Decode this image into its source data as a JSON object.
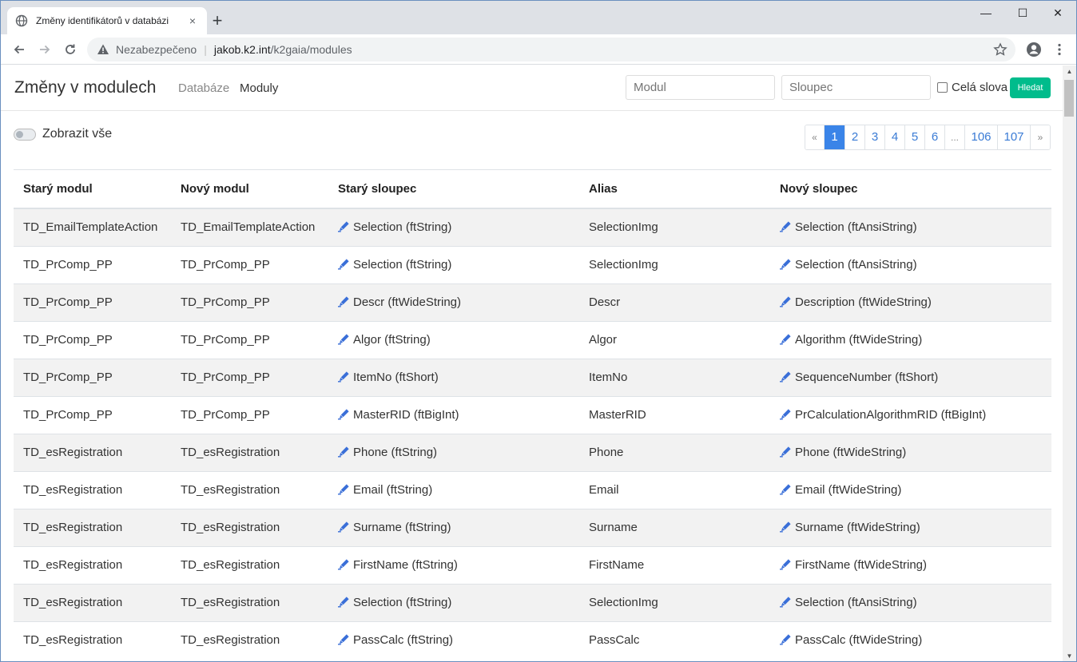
{
  "browser": {
    "tab_title": "Změny identifikátorů v databázi",
    "tab_close": "×",
    "new_tab": "+",
    "minimize": "—",
    "maximize": "☐",
    "close": "✕",
    "address": {
      "security_label": "Nezabezpečeno",
      "separator": "|",
      "host": "jakob.k2.int",
      "path": "/k2gaia/modules"
    }
  },
  "navbar": {
    "brand": "Změny v modulech",
    "links": [
      {
        "label": "Databáze",
        "active": false
      },
      {
        "label": "Moduly",
        "active": true
      }
    ],
    "search_module_placeholder": "Modul",
    "search_column_placeholder": "Sloupec",
    "whole_words_label": "Celá slova",
    "search_button": "Hledat"
  },
  "toolbar": {
    "show_all_label": "Zobrazit vše",
    "show_all_on": false
  },
  "pagination": {
    "prev": "«",
    "pages": [
      "1",
      "2",
      "3",
      "4",
      "5",
      "6",
      "...",
      "106",
      "107"
    ],
    "active_page": "1",
    "next": "»"
  },
  "table": {
    "headers": [
      "Starý modul",
      "Nový modul",
      "Starý sloupec",
      "Alias",
      "Nový sloupec"
    ],
    "rows": [
      [
        "TD_EmailTemplateAction",
        "TD_EmailTemplateAction",
        "Selection (ftString)",
        "SelectionImg",
        "Selection (ftAnsiString)"
      ],
      [
        "TD_PrComp_PP",
        "TD_PrComp_PP",
        "Selection (ftString)",
        "SelectionImg",
        "Selection (ftAnsiString)"
      ],
      [
        "TD_PrComp_PP",
        "TD_PrComp_PP",
        "Descr (ftWideString)",
        "Descr",
        "Description (ftWideString)"
      ],
      [
        "TD_PrComp_PP",
        "TD_PrComp_PP",
        "Algor (ftString)",
        "Algor",
        "Algorithm (ftWideString)"
      ],
      [
        "TD_PrComp_PP",
        "TD_PrComp_PP",
        "ItemNo (ftShort)",
        "ItemNo",
        "SequenceNumber (ftShort)"
      ],
      [
        "TD_PrComp_PP",
        "TD_PrComp_PP",
        "MasterRID (ftBigInt)",
        "MasterRID",
        "PrCalculationAlgorithmRID (ftBigInt)"
      ],
      [
        "TD_esRegistration",
        "TD_esRegistration",
        "Phone (ftString)",
        "Phone",
        "Phone (ftWideString)"
      ],
      [
        "TD_esRegistration",
        "TD_esRegistration",
        "Email (ftString)",
        "Email",
        "Email (ftWideString)"
      ],
      [
        "TD_esRegistration",
        "TD_esRegistration",
        "Surname (ftString)",
        "Surname",
        "Surname (ftWideString)"
      ],
      [
        "TD_esRegistration",
        "TD_esRegistration",
        "FirstName (ftString)",
        "FirstName",
        "FirstName (ftWideString)"
      ],
      [
        "TD_esRegistration",
        "TD_esRegistration",
        "Selection (ftString)",
        "SelectionImg",
        "Selection (ftAnsiString)"
      ],
      [
        "TD_esRegistration",
        "TD_esRegistration",
        "PassCalc (ftString)",
        "PassCalc",
        "PassCalc (ftWideString)"
      ]
    ]
  },
  "colors": {
    "accent": "#3a84e8",
    "success": "#00bc8c",
    "pen_icon": "#3a6fd8",
    "stripe": "#f2f2f2"
  }
}
